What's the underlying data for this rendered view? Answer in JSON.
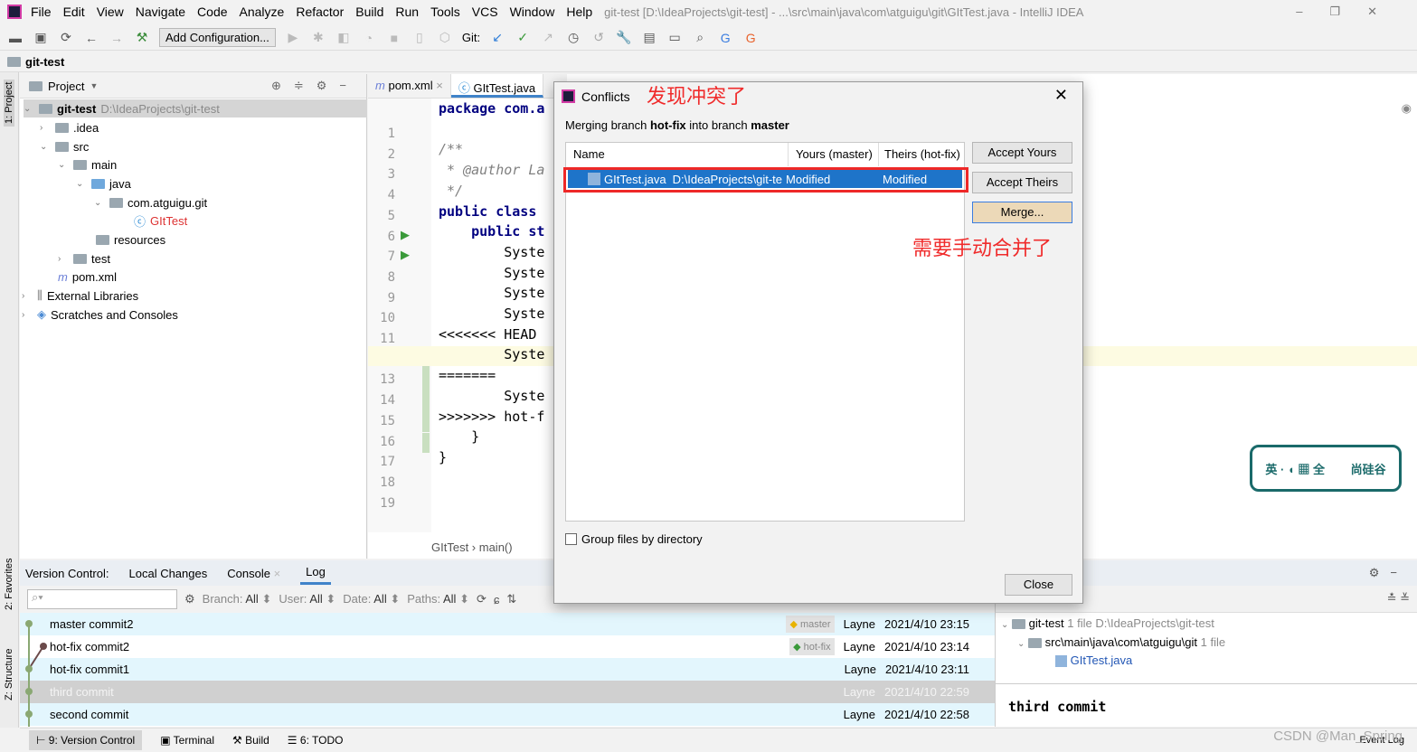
{
  "menubar": {
    "items": [
      "File",
      "Edit",
      "View",
      "Navigate",
      "Code",
      "Analyze",
      "Refactor",
      "Build",
      "Run",
      "Tools",
      "VCS",
      "Window",
      "Help"
    ],
    "window_title": "git-test [D:\\IdeaProjects\\git-test] - ...\\src\\main\\java\\com\\atguigu\\git\\GItTest.java - IntelliJ IDEA"
  },
  "toolbar": {
    "add_configuration": "Add Configuration...",
    "git_label": "Git:"
  },
  "breadcrumb": {
    "project": "git-test"
  },
  "left_stripe": {
    "project": "1: Project",
    "favorites": "2: Favorites",
    "structure": "Z: Structure"
  },
  "project_panel": {
    "title": "Project",
    "tree": [
      {
        "label": "git-test",
        "extra": "D:\\IdeaProjects\\git-test"
      },
      {
        "label": ".idea"
      },
      {
        "label": "src"
      },
      {
        "label": "main"
      },
      {
        "label": "java"
      },
      {
        "label": "com.atguigu.git"
      },
      {
        "label": "GItTest"
      },
      {
        "label": "resources"
      },
      {
        "label": "test"
      },
      {
        "label": "pom.xml"
      },
      {
        "label": "External Libraries"
      },
      {
        "label": "Scratches and Consoles"
      }
    ]
  },
  "editor": {
    "tabs": [
      "pom.xml",
      "GItTest.java"
    ],
    "lines": [
      "package com.a",
      "",
      "/**",
      " * @author La",
      " */",
      "public class",
      "    public st",
      "        Syste",
      "        Syste",
      "        Syste",
      "        Syste",
      "<<<<<<< HEAD",
      "        Syste",
      "=======",
      "        Syste",
      ">>>>>>> hot-f",
      "    }",
      "}",
      ""
    ],
    "breadcrumb": [
      "GItTest",
      "main()"
    ]
  },
  "dialog": {
    "title": "Conflicts",
    "annotation_title": "发现冲突了",
    "annotation_merge": "需要手动合并了",
    "subtitle_pre": "Merging branch ",
    "branch_from": "hot-fix",
    "subtitle_mid": " into branch ",
    "branch_to": "master",
    "columns": [
      "Name",
      "Yours (master)",
      "Theirs (hot-fix)"
    ],
    "row": {
      "name": "GItTest.java",
      "path": "D:\\IdeaProjects\\git-te",
      "yours": "Modified",
      "theirs": "Modified"
    },
    "buttons": {
      "accept_yours": "Accept Yours",
      "accept_theirs": "Accept Theirs",
      "merge": "Merge...",
      "close": "Close"
    },
    "group_by_dir": "Group files by directory"
  },
  "bottom": {
    "tabs": [
      "Version Control:",
      "Local Changes",
      "Console",
      "Log"
    ],
    "filters": {
      "branch": "Branch:",
      "user": "User:",
      "date": "Date:",
      "paths": "Paths:",
      "all": "All"
    },
    "commits": [
      {
        "msg": "master commit2",
        "tag": "master",
        "author": "Layne",
        "date": "2021/4/10 23:15"
      },
      {
        "msg": "hot-fix commit2",
        "tag": "hot-fix",
        "author": "Layne",
        "date": "2021/4/10 23:14"
      },
      {
        "msg": "hot-fix commit1",
        "tag": "",
        "author": "Layne",
        "date": "2021/4/10 23:11"
      },
      {
        "msg": "third commit",
        "tag": "",
        "author": "Layne",
        "date": "2021/4/10 22:59"
      },
      {
        "msg": "second commit",
        "tag": "",
        "author": "Layne",
        "date": "2021/4/10 22:58"
      }
    ],
    "details": {
      "root": "git-test",
      "root_count": "1 file",
      "root_path": "D:\\IdeaProjects\\git-test",
      "dir": "src\\main\\java\\com\\atguigu\\git",
      "dir_count": "1 file",
      "file": "GItTest.java",
      "commit_message": "third commit"
    }
  },
  "statusbar": {
    "items": [
      "9: Version Control",
      "Terminal",
      "Build",
      "6: TODO"
    ],
    "event_log": "Event Log",
    "watermark": "CSDN @Man_Spring"
  },
  "colors": {
    "selection": "#1e74c9",
    "annotation": "#f02b2b",
    "graph_master": "#8aa873",
    "graph_hotfix": "#6b4a4a"
  }
}
